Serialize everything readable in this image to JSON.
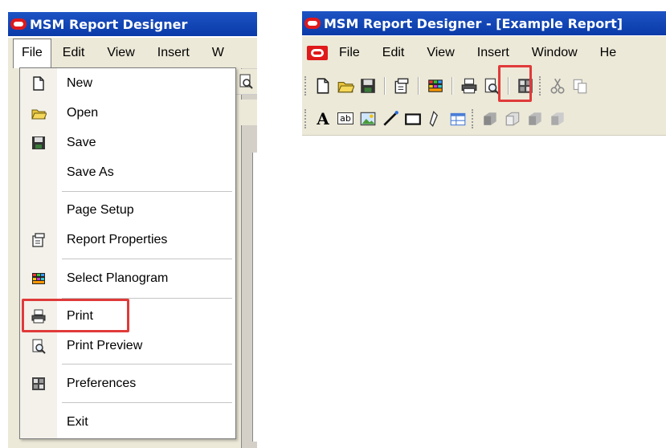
{
  "left_window": {
    "title": "MSM Report Designer",
    "menu": [
      "File",
      "Edit",
      "View",
      "Insert",
      "W"
    ],
    "file_menu_items": [
      {
        "label": "New",
        "icon": "new-document-icon"
      },
      {
        "label": "Open",
        "icon": "open-folder-icon"
      },
      {
        "label": "Save",
        "icon": "save-disk-icon"
      },
      {
        "label": "Save As",
        "icon": ""
      },
      {
        "label": "Page Setup",
        "icon": ""
      },
      {
        "label": "Report Properties",
        "icon": "report-properties-icon"
      },
      {
        "label": "Select Planogram",
        "icon": "planogram-icon"
      },
      {
        "label": "Print",
        "icon": "printer-icon"
      },
      {
        "label": "Print Preview",
        "icon": "print-preview-icon"
      },
      {
        "label": "Preferences",
        "icon": "preferences-icon"
      },
      {
        "label": "Exit",
        "icon": ""
      }
    ],
    "highlighted_item": "Print"
  },
  "right_window": {
    "title": "MSM Report Designer - [Example Report]",
    "menu": [
      "File",
      "Edit",
      "View",
      "Insert",
      "Window",
      "He"
    ],
    "toolbar1_icons": [
      "new-document-icon",
      "open-folder-icon",
      "save-disk-icon",
      "report-properties-icon",
      "planogram-icon",
      "printer-icon",
      "print-preview-icon",
      "preferences-icon",
      "cut-icon",
      "copy-icon"
    ],
    "toolbar2_icons": [
      "text-icon",
      "textbox-icon",
      "image-icon",
      "line-icon",
      "rectangle-icon",
      "pen-icon",
      "table-icon",
      "cube-icon",
      "cube-outline-icon",
      "cube-front-icon",
      "cube-back-icon"
    ],
    "text_tool_glyph": "A",
    "textbox_glyph": "ab",
    "highlighted_icon": "printer-icon"
  },
  "colors": {
    "title_blue": "#0a3aa8",
    "highlight_red": "#e03a3a",
    "oracle_red": "#e0191b"
  }
}
